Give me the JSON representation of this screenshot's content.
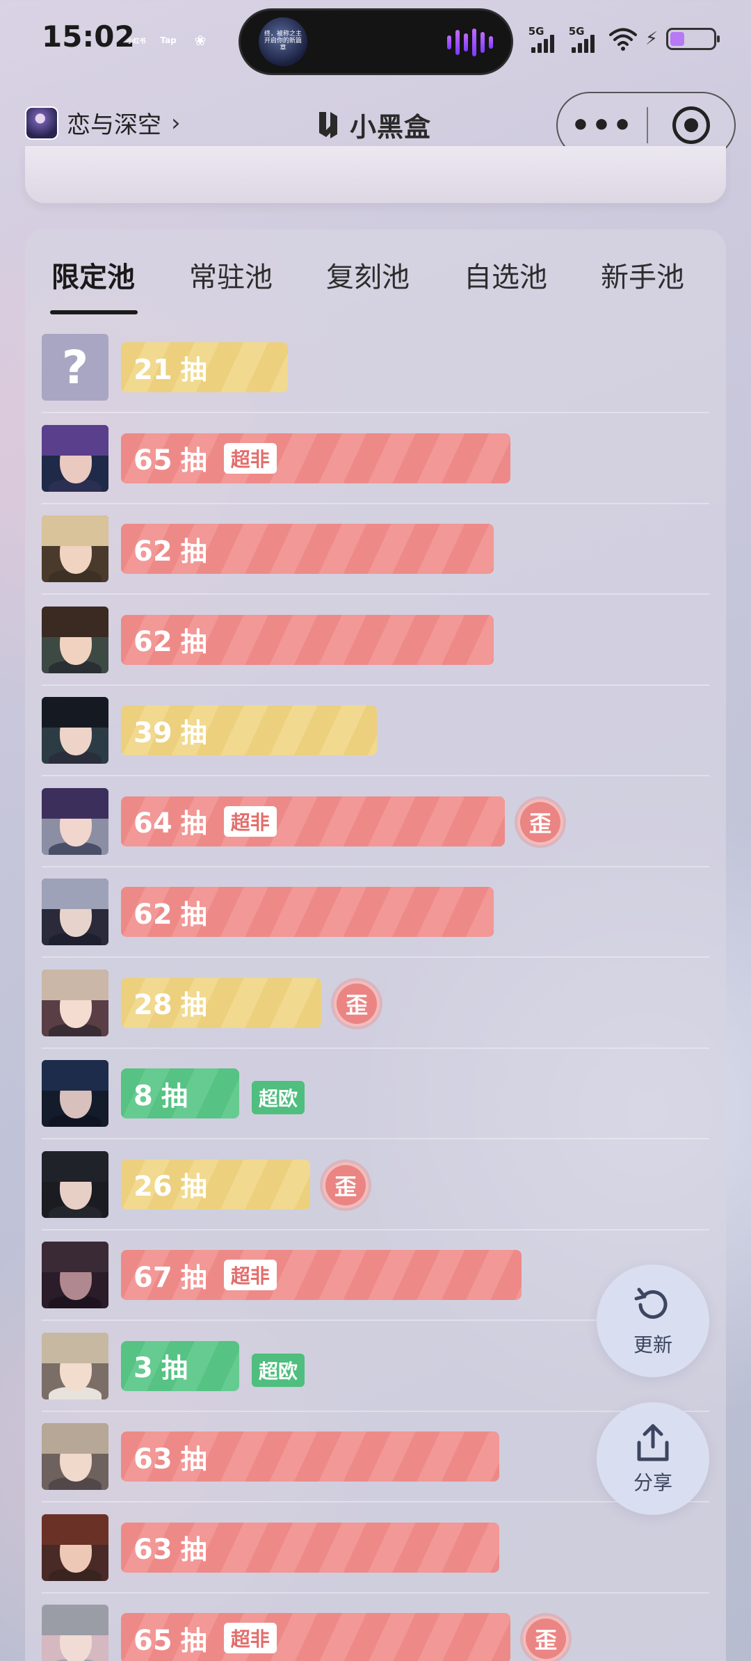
{
  "status_bar": {
    "time": "15:02",
    "apps": [
      {
        "label": "小红书",
        "color": "#ff2442"
      },
      {
        "label": "Tap",
        "color": "#17c4d6"
      },
      {
        "label": "❀",
        "color": "#f23c55"
      }
    ],
    "island_text": "终，被称之主\n开启你的新篇章",
    "signal_labels": [
      "5G",
      "5G"
    ],
    "battery_color": "#b879f5"
  },
  "nav": {
    "title": "恋与深空",
    "chevron": "›",
    "brand": "小黑盒",
    "more": "•••"
  },
  "tabs": [
    "限定池",
    "常驻池",
    "复刻池",
    "自选池",
    "新手池"
  ],
  "rows": [
    {
      "count": "21",
      "unit": "抽",
      "color": "yellow",
      "fill": 0.3,
      "tag": "",
      "tag_type": "",
      "wai": "",
      "avatar": "unknown",
      "unknown_mark": "?"
    },
    {
      "count": "65",
      "unit": "抽",
      "color": "red",
      "fill": 0.7,
      "tag": "超非",
      "tag_type": "in",
      "wai": "",
      "avatar": "purple"
    },
    {
      "count": "62",
      "unit": "抽",
      "color": "red",
      "fill": 0.67,
      "tag": "",
      "tag_type": "",
      "wai": "",
      "avatar": "blond"
    },
    {
      "count": "62",
      "unit": "抽",
      "color": "red",
      "fill": 0.67,
      "tag": "",
      "tag_type": "",
      "wai": "",
      "avatar": "brown"
    },
    {
      "count": "39",
      "unit": "抽",
      "color": "yellow",
      "fill": 0.46,
      "tag": "",
      "tag_type": "",
      "wai": "",
      "avatar": "dark"
    },
    {
      "count": "64",
      "unit": "抽",
      "color": "red",
      "fill": 0.69,
      "tag": "超非",
      "tag_type": "in",
      "wai": "歪",
      "avatar": "purple2"
    },
    {
      "count": "62",
      "unit": "抽",
      "color": "red",
      "fill": 0.67,
      "tag": "",
      "tag_type": "",
      "wai": "",
      "avatar": "silver"
    },
    {
      "count": "28",
      "unit": "抽",
      "color": "yellow",
      "fill": 0.36,
      "tag": "",
      "tag_type": "",
      "wai": "歪",
      "avatar": "light"
    },
    {
      "count": "8",
      "unit": "抽",
      "color": "green",
      "fill": 0.18,
      "tag": "超欧",
      "tag_type": "out",
      "wai": "",
      "avatar": "navy"
    },
    {
      "count": "26",
      "unit": "抽",
      "color": "yellow",
      "fill": 0.34,
      "tag": "",
      "tag_type": "",
      "wai": "歪",
      "avatar": "suit"
    },
    {
      "count": "67",
      "unit": "抽",
      "color": "red",
      "fill": 0.72,
      "tag": "超非",
      "tag_type": "in",
      "wai": "",
      "avatar": "masked"
    },
    {
      "count": "3",
      "unit": "抽",
      "color": "green",
      "fill": 0.13,
      "tag": "超欧",
      "tag_type": "out",
      "wai": "",
      "avatar": "blond2"
    },
    {
      "count": "63",
      "unit": "抽",
      "color": "red",
      "fill": 0.68,
      "tag": "",
      "tag_type": "",
      "wai": "",
      "avatar": "blond3"
    },
    {
      "count": "63",
      "unit": "抽",
      "color": "red",
      "fill": 0.68,
      "tag": "",
      "tag_type": "",
      "wai": "",
      "avatar": "auburn"
    },
    {
      "count": "65",
      "unit": "抽",
      "color": "red",
      "fill": 0.7,
      "tag": "超非",
      "tag_type": "in",
      "wai": "歪",
      "avatar": "silver2"
    }
  ],
  "fabs": {
    "refresh_label": "更新",
    "share_label": "分享"
  }
}
